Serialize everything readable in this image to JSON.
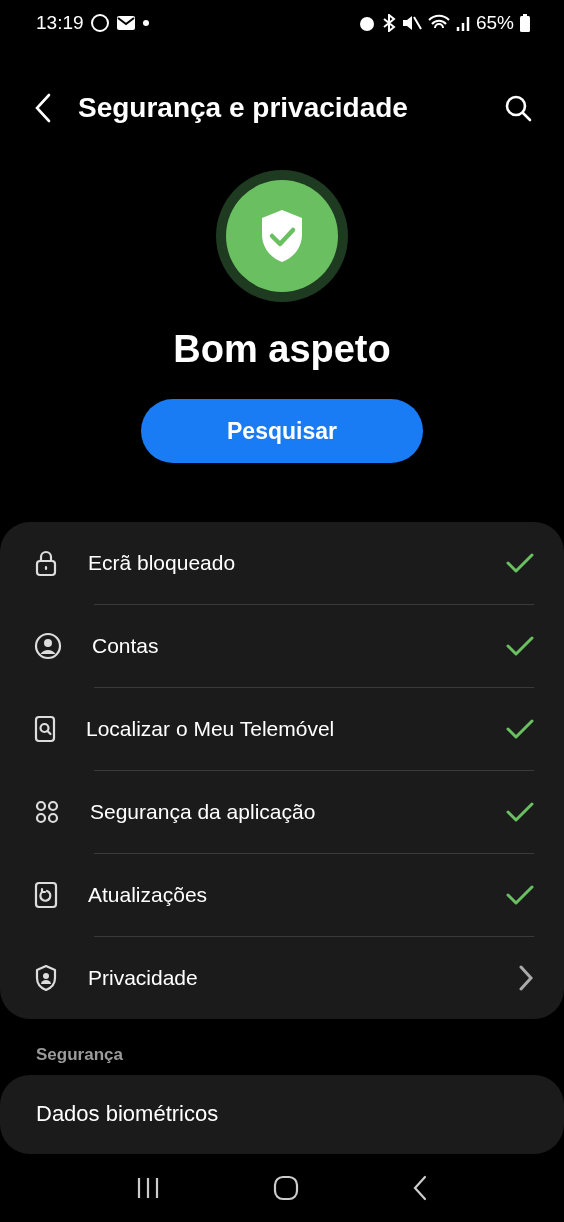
{
  "status_bar": {
    "time": "13:19",
    "battery": "65%"
  },
  "header": {
    "title": "Segurança e privacidade"
  },
  "summary": {
    "status": "Bom aspeto",
    "button": "Pesquisar"
  },
  "items": [
    {
      "label": "Ecrã bloqueado",
      "kind": "check"
    },
    {
      "label": "Contas",
      "kind": "check"
    },
    {
      "label": "Localizar o Meu Telemóvel",
      "kind": "check"
    },
    {
      "label": "Segurança da aplicação",
      "kind": "check"
    },
    {
      "label": "Atualizações",
      "kind": "check"
    },
    {
      "label": "Privacidade",
      "kind": "chevron"
    }
  ],
  "section": {
    "title": "Segurança",
    "items": [
      {
        "label": "Dados biométricos"
      }
    ]
  }
}
